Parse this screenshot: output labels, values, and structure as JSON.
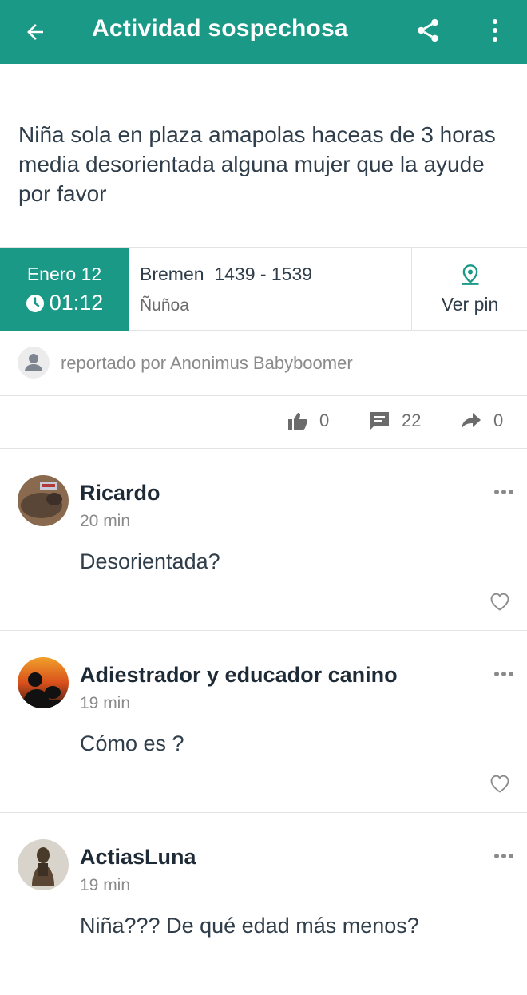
{
  "header": {
    "title": "Actividad sospechosa",
    "icons": {
      "back": "arrow-left-icon",
      "share": "share-icon",
      "more": "more-vertical-icon"
    },
    "color": "#1a9a86"
  },
  "report": {
    "description": "Niña sola en plaza amapolas haceas de 3 horas media desorientada alguna mujer que la ayude por favor",
    "date": "Enero 12",
    "time": "01:12",
    "street": "Bremen  1439 - 1539",
    "district": "Ñuñoa",
    "pin_label": "Ver pin",
    "reporter": "reportado por Anonimus Babyboomer"
  },
  "stats": {
    "likes": "0",
    "comments": "22",
    "shares": "0"
  },
  "comments": [
    {
      "author": "Ricardo",
      "time": "20 min",
      "text": "Desorientada?"
    },
    {
      "author": "Adiestrador y educador canino",
      "time": "19 min",
      "text": "Cómo es ?"
    },
    {
      "author": "ActiasLuna",
      "time": "19 min",
      "text": "Niña??? De qué edad más menos?"
    }
  ]
}
